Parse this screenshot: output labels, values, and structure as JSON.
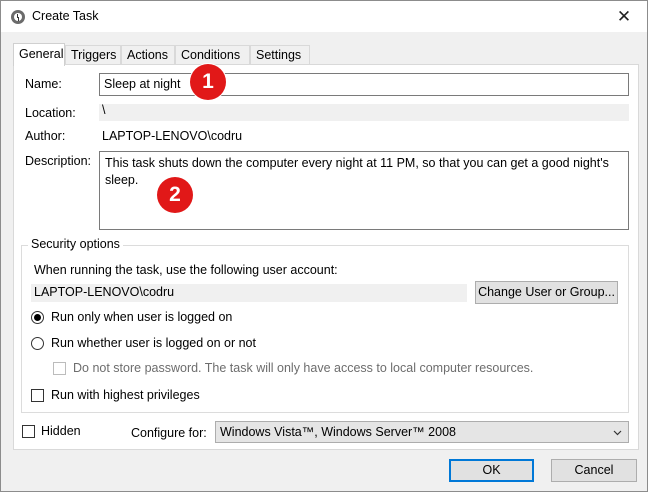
{
  "window": {
    "title": "Create Task",
    "close_glyph": "✕"
  },
  "tabs": [
    {
      "label": "General",
      "active": true
    },
    {
      "label": "Triggers"
    },
    {
      "label": "Actions"
    },
    {
      "label": "Conditions"
    },
    {
      "label": "Settings"
    }
  ],
  "general": {
    "name_label": "Name:",
    "name_value": "Sleep at night",
    "location_label": "Location:",
    "location_value": "\\",
    "author_label": "Author:",
    "author_value": "LAPTOP-LENOVO\\codru",
    "description_label": "Description:",
    "description_value": "This task shuts down the computer every night at 11 PM, so that you can get a good night's sleep."
  },
  "security": {
    "group_title": "Security options",
    "account_prompt": "When running the task, use the following user account:",
    "account_value": "LAPTOP-LENOVO\\codru",
    "change_button": "Change User or Group...",
    "radio_logged_on": "Run only when user is logged on",
    "radio_whether": "Run whether user is logged on or not",
    "no_store_password": "Do not store password.  The task will only have access to local computer resources.",
    "highest_privileges": "Run with highest privileges"
  },
  "footer": {
    "hidden_label": "Hidden",
    "configure_label": "Configure for:",
    "configure_value": "Windows Vista™, Windows Server™ 2008",
    "ok": "OK",
    "cancel": "Cancel"
  },
  "annotations": {
    "badge_1": "1",
    "badge_2": "2"
  },
  "colors": {
    "badge": "#e11818",
    "default_button_border": "#0078d7",
    "accent": "#0078d7"
  },
  "icons": {
    "title": "task-scheduler-clock-icon",
    "close": "close-icon",
    "dropdown": "chevron-down-icon"
  }
}
